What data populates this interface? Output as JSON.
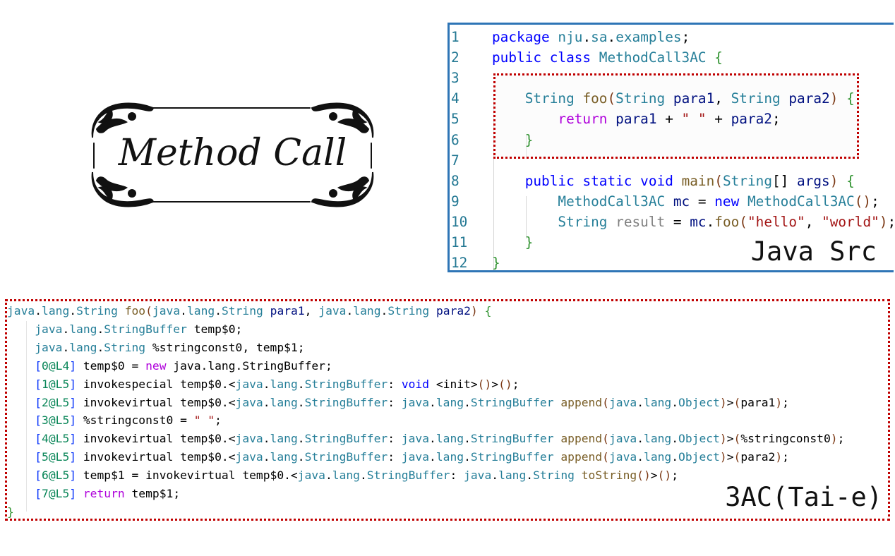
{
  "title": "Method Call",
  "java_panel": {
    "label": "Java Src",
    "lines": [
      {
        "n": "1",
        "tokens": [
          [
            "kw",
            "package"
          ],
          [
            "pl",
            " "
          ],
          [
            "ty",
            "nju"
          ],
          [
            "pl",
            "."
          ],
          [
            "ty",
            "sa"
          ],
          [
            "pl",
            "."
          ],
          [
            "ty",
            "examples"
          ],
          [
            "pl",
            ";"
          ]
        ]
      },
      {
        "n": "2",
        "tokens": [
          [
            "kw",
            "public"
          ],
          [
            "pl",
            " "
          ],
          [
            "kw",
            "class"
          ],
          [
            "pl",
            " "
          ],
          [
            "ty",
            "MethodCall3AC"
          ],
          [
            "pl",
            " "
          ],
          [
            "br1",
            "{"
          ]
        ]
      },
      {
        "n": "3",
        "tokens": []
      },
      {
        "n": "4",
        "tokens": [
          [
            "pl",
            "    "
          ],
          [
            "ty",
            "String"
          ],
          [
            "pl",
            " "
          ],
          [
            "fn",
            "foo"
          ],
          [
            "br2",
            "("
          ],
          [
            "ty",
            "String"
          ],
          [
            "pl",
            " "
          ],
          [
            "var",
            "para1"
          ],
          [
            "pl",
            ", "
          ],
          [
            "ty",
            "String"
          ],
          [
            "pl",
            " "
          ],
          [
            "var",
            "para2"
          ],
          [
            "br2",
            ")"
          ],
          [
            "pl",
            " "
          ],
          [
            "br1",
            "{"
          ]
        ]
      },
      {
        "n": "5",
        "tokens": [
          [
            "pl",
            "        "
          ],
          [
            "kwp",
            "return"
          ],
          [
            "pl",
            " "
          ],
          [
            "var",
            "para1"
          ],
          [
            "pl",
            " + "
          ],
          [
            "str",
            "\" \""
          ],
          [
            "pl",
            " + "
          ],
          [
            "var",
            "para2"
          ],
          [
            "pl",
            ";"
          ]
        ]
      },
      {
        "n": "6",
        "tokens": [
          [
            "pl",
            "    "
          ],
          [
            "br1",
            "}"
          ]
        ]
      },
      {
        "n": "7",
        "tokens": []
      },
      {
        "n": "8",
        "tokens": [
          [
            "pl",
            "    "
          ],
          [
            "kw",
            "public"
          ],
          [
            "pl",
            " "
          ],
          [
            "kw",
            "static"
          ],
          [
            "pl",
            " "
          ],
          [
            "kw",
            "void"
          ],
          [
            "pl",
            " "
          ],
          [
            "fn",
            "main"
          ],
          [
            "br2",
            "("
          ],
          [
            "ty",
            "String"
          ],
          [
            "pl",
            "[] "
          ],
          [
            "var",
            "args"
          ],
          [
            "br2",
            ")"
          ],
          [
            "pl",
            " "
          ],
          [
            "br1",
            "{"
          ]
        ]
      },
      {
        "n": "9",
        "tokens": [
          [
            "pl",
            "        "
          ],
          [
            "ty",
            "MethodCall3AC"
          ],
          [
            "pl",
            " "
          ],
          [
            "var",
            "mc"
          ],
          [
            "pl",
            " = "
          ],
          [
            "kw",
            "new"
          ],
          [
            "pl",
            " "
          ],
          [
            "ty",
            "MethodCall3AC"
          ],
          [
            "br2",
            "()"
          ],
          [
            "pl",
            ";"
          ]
        ]
      },
      {
        "n": "10",
        "tokens": [
          [
            "pl",
            "        "
          ],
          [
            "ty",
            "String"
          ],
          [
            "pl",
            " "
          ],
          [
            "gr",
            "result"
          ],
          [
            "pl",
            " = "
          ],
          [
            "var",
            "mc"
          ],
          [
            "pl",
            "."
          ],
          [
            "fn",
            "foo"
          ],
          [
            "br2",
            "("
          ],
          [
            "str",
            "\"hello\""
          ],
          [
            "pl",
            ", "
          ],
          [
            "str",
            "\"world\""
          ],
          [
            "br2",
            ")"
          ],
          [
            "pl",
            ";"
          ]
        ]
      },
      {
        "n": "11",
        "tokens": [
          [
            "pl",
            "    "
          ],
          [
            "br1",
            "}"
          ]
        ]
      },
      {
        "n": "12",
        "tokens": [
          [
            "br1",
            "}"
          ]
        ]
      }
    ]
  },
  "tac_panel": {
    "label": "3AC(Tai-e)",
    "lines": [
      [
        [
          "ty",
          "java"
        ],
        [
          "pl",
          "."
        ],
        [
          "ty",
          "lang"
        ],
        [
          "pl",
          "."
        ],
        [
          "ty",
          "String"
        ],
        [
          "pl",
          " "
        ],
        [
          "fn",
          "foo"
        ],
        [
          "br2",
          "("
        ],
        [
          "ty",
          "java"
        ],
        [
          "pl",
          "."
        ],
        [
          "ty",
          "lang"
        ],
        [
          "pl",
          "."
        ],
        [
          "ty",
          "String"
        ],
        [
          "pl",
          " "
        ],
        [
          "var",
          "para1"
        ],
        [
          "pl",
          ", "
        ],
        [
          "ty",
          "java"
        ],
        [
          "pl",
          "."
        ],
        [
          "ty",
          "lang"
        ],
        [
          "pl",
          "."
        ],
        [
          "ty",
          "String"
        ],
        [
          "pl",
          " "
        ],
        [
          "var",
          "para2"
        ],
        [
          "br2",
          ")"
        ],
        [
          "pl",
          " "
        ],
        [
          "br1",
          "{"
        ]
      ],
      [
        [
          "pl",
          "    "
        ],
        [
          "ty",
          "java"
        ],
        [
          "pl",
          "."
        ],
        [
          "ty",
          "lang"
        ],
        [
          "pl",
          "."
        ],
        [
          "ty",
          "StringBuffer"
        ],
        [
          "pl",
          " temp$0;"
        ]
      ],
      [
        [
          "pl",
          "    "
        ],
        [
          "ty",
          "java"
        ],
        [
          "pl",
          "."
        ],
        [
          "ty",
          "lang"
        ],
        [
          "pl",
          "."
        ],
        [
          "ty",
          "String"
        ],
        [
          "pl",
          " %stringconst0, temp$1;"
        ]
      ],
      [
        [
          "pl",
          "    "
        ],
        [
          "br3",
          "["
        ],
        [
          "lbl",
          "0@L4"
        ],
        [
          "br3",
          "]"
        ],
        [
          "pl",
          " temp$0 = "
        ],
        [
          "kwp",
          "new"
        ],
        [
          "pl",
          " java.lang.StringBuffer;"
        ]
      ],
      [
        [
          "pl",
          "    "
        ],
        [
          "br3",
          "["
        ],
        [
          "lbl",
          "1@L5"
        ],
        [
          "br3",
          "]"
        ],
        [
          "pl",
          " invokespecial temp$0.<"
        ],
        [
          "ty",
          "java"
        ],
        [
          "pl",
          "."
        ],
        [
          "ty",
          "lang"
        ],
        [
          "pl",
          "."
        ],
        [
          "ty",
          "StringBuffer"
        ],
        [
          "pl",
          ": "
        ],
        [
          "kw",
          "void"
        ],
        [
          "pl",
          " <init>"
        ],
        [
          "br2",
          "()"
        ],
        [
          "pl",
          ">"
        ],
        [
          "br2",
          "()"
        ],
        [
          "pl",
          ";"
        ]
      ],
      [
        [
          "pl",
          "    "
        ],
        [
          "br3",
          "["
        ],
        [
          "lbl",
          "2@L5"
        ],
        [
          "br3",
          "]"
        ],
        [
          "pl",
          " invokevirtual temp$0.<"
        ],
        [
          "ty",
          "java"
        ],
        [
          "pl",
          "."
        ],
        [
          "ty",
          "lang"
        ],
        [
          "pl",
          "."
        ],
        [
          "ty",
          "StringBuffer"
        ],
        [
          "pl",
          ": "
        ],
        [
          "ty",
          "java"
        ],
        [
          "pl",
          "."
        ],
        [
          "ty",
          "lang"
        ],
        [
          "pl",
          "."
        ],
        [
          "ty",
          "StringBuffer"
        ],
        [
          "pl",
          " "
        ],
        [
          "fn",
          "append"
        ],
        [
          "br2",
          "("
        ],
        [
          "ty",
          "java"
        ],
        [
          "pl",
          "."
        ],
        [
          "ty",
          "lang"
        ],
        [
          "pl",
          "."
        ],
        [
          "ty",
          "Object"
        ],
        [
          "br2",
          ")"
        ],
        [
          "pl",
          ">"
        ],
        [
          "br2",
          "("
        ],
        [
          "pl",
          "para1"
        ],
        [
          "br2",
          ")"
        ],
        [
          "pl",
          ";"
        ]
      ],
      [
        [
          "pl",
          "    "
        ],
        [
          "br3",
          "["
        ],
        [
          "lbl",
          "3@L5"
        ],
        [
          "br3",
          "]"
        ],
        [
          "pl",
          " %stringconst0 = "
        ],
        [
          "str",
          "\" \""
        ],
        [
          "pl",
          ";"
        ]
      ],
      [
        [
          "pl",
          "    "
        ],
        [
          "br3",
          "["
        ],
        [
          "lbl",
          "4@L5"
        ],
        [
          "br3",
          "]"
        ],
        [
          "pl",
          " invokevirtual temp$0.<"
        ],
        [
          "ty",
          "java"
        ],
        [
          "pl",
          "."
        ],
        [
          "ty",
          "lang"
        ],
        [
          "pl",
          "."
        ],
        [
          "ty",
          "StringBuffer"
        ],
        [
          "pl",
          ": "
        ],
        [
          "ty",
          "java"
        ],
        [
          "pl",
          "."
        ],
        [
          "ty",
          "lang"
        ],
        [
          "pl",
          "."
        ],
        [
          "ty",
          "StringBuffer"
        ],
        [
          "pl",
          " "
        ],
        [
          "fn",
          "append"
        ],
        [
          "br2",
          "("
        ],
        [
          "ty",
          "java"
        ],
        [
          "pl",
          "."
        ],
        [
          "ty",
          "lang"
        ],
        [
          "pl",
          "."
        ],
        [
          "ty",
          "Object"
        ],
        [
          "br2",
          ")"
        ],
        [
          "pl",
          ">"
        ],
        [
          "br2",
          "("
        ],
        [
          "pl",
          "%stringconst0"
        ],
        [
          "br2",
          ")"
        ],
        [
          "pl",
          ";"
        ]
      ],
      [
        [
          "pl",
          "    "
        ],
        [
          "br3",
          "["
        ],
        [
          "lbl",
          "5@L5"
        ],
        [
          "br3",
          "]"
        ],
        [
          "pl",
          " invokevirtual temp$0.<"
        ],
        [
          "ty",
          "java"
        ],
        [
          "pl",
          "."
        ],
        [
          "ty",
          "lang"
        ],
        [
          "pl",
          "."
        ],
        [
          "ty",
          "StringBuffer"
        ],
        [
          "pl",
          ": "
        ],
        [
          "ty",
          "java"
        ],
        [
          "pl",
          "."
        ],
        [
          "ty",
          "lang"
        ],
        [
          "pl",
          "."
        ],
        [
          "ty",
          "StringBuffer"
        ],
        [
          "pl",
          " "
        ],
        [
          "fn",
          "append"
        ],
        [
          "br2",
          "("
        ],
        [
          "ty",
          "java"
        ],
        [
          "pl",
          "."
        ],
        [
          "ty",
          "lang"
        ],
        [
          "pl",
          "."
        ],
        [
          "ty",
          "Object"
        ],
        [
          "br2",
          ")"
        ],
        [
          "pl",
          ">"
        ],
        [
          "br2",
          "("
        ],
        [
          "pl",
          "para2"
        ],
        [
          "br2",
          ")"
        ],
        [
          "pl",
          ";"
        ]
      ],
      [
        [
          "pl",
          "    "
        ],
        [
          "br3",
          "["
        ],
        [
          "lbl",
          "6@L5"
        ],
        [
          "br3",
          "]"
        ],
        [
          "pl",
          " temp$1 = invokevirtual temp$0.<"
        ],
        [
          "ty",
          "java"
        ],
        [
          "pl",
          "."
        ],
        [
          "ty",
          "lang"
        ],
        [
          "pl",
          "."
        ],
        [
          "ty",
          "StringBuffer"
        ],
        [
          "pl",
          ": "
        ],
        [
          "ty",
          "java"
        ],
        [
          "pl",
          "."
        ],
        [
          "ty",
          "lang"
        ],
        [
          "pl",
          "."
        ],
        [
          "ty",
          "String"
        ],
        [
          "pl",
          " "
        ],
        [
          "fn",
          "toString"
        ],
        [
          "br2",
          "()"
        ],
        [
          "pl",
          ">"
        ],
        [
          "br2",
          "()"
        ],
        [
          "pl",
          ";"
        ]
      ],
      [
        [
          "pl",
          "    "
        ],
        [
          "br3",
          "["
        ],
        [
          "lbl",
          "7@L5"
        ],
        [
          "br3",
          "]"
        ],
        [
          "pl",
          " "
        ],
        [
          "kwp",
          "return"
        ],
        [
          "pl",
          " temp$1;"
        ]
      ],
      [
        [
          "br1",
          "}"
        ]
      ]
    ]
  }
}
